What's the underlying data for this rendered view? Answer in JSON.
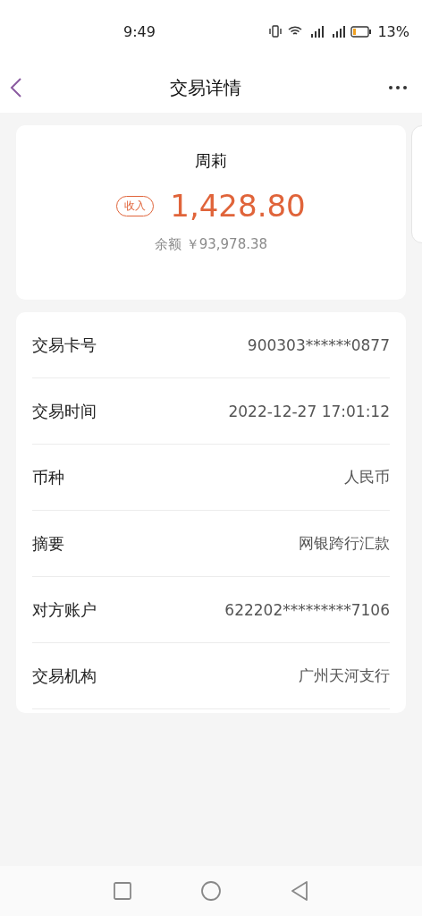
{
  "status_bar": {
    "time": "9:49",
    "battery_percent": "13%"
  },
  "header": {
    "title": "交易详情"
  },
  "summary": {
    "name": "周莉",
    "tag": "收入",
    "amount": "1,428.80",
    "balance_label": "余额",
    "balance": "￥93,978.38"
  },
  "details": [
    {
      "label": "交易卡号",
      "value": "900303******0877"
    },
    {
      "label": "交易时间",
      "value": "2022-12-27 17:01:12"
    },
    {
      "label": "币种",
      "value": "人民币"
    },
    {
      "label": "摘要",
      "value": "网银跨行汇款"
    },
    {
      "label": "对方账户",
      "value": "622202*********7106"
    },
    {
      "label": "交易机构",
      "value": "广州天河支行"
    }
  ]
}
